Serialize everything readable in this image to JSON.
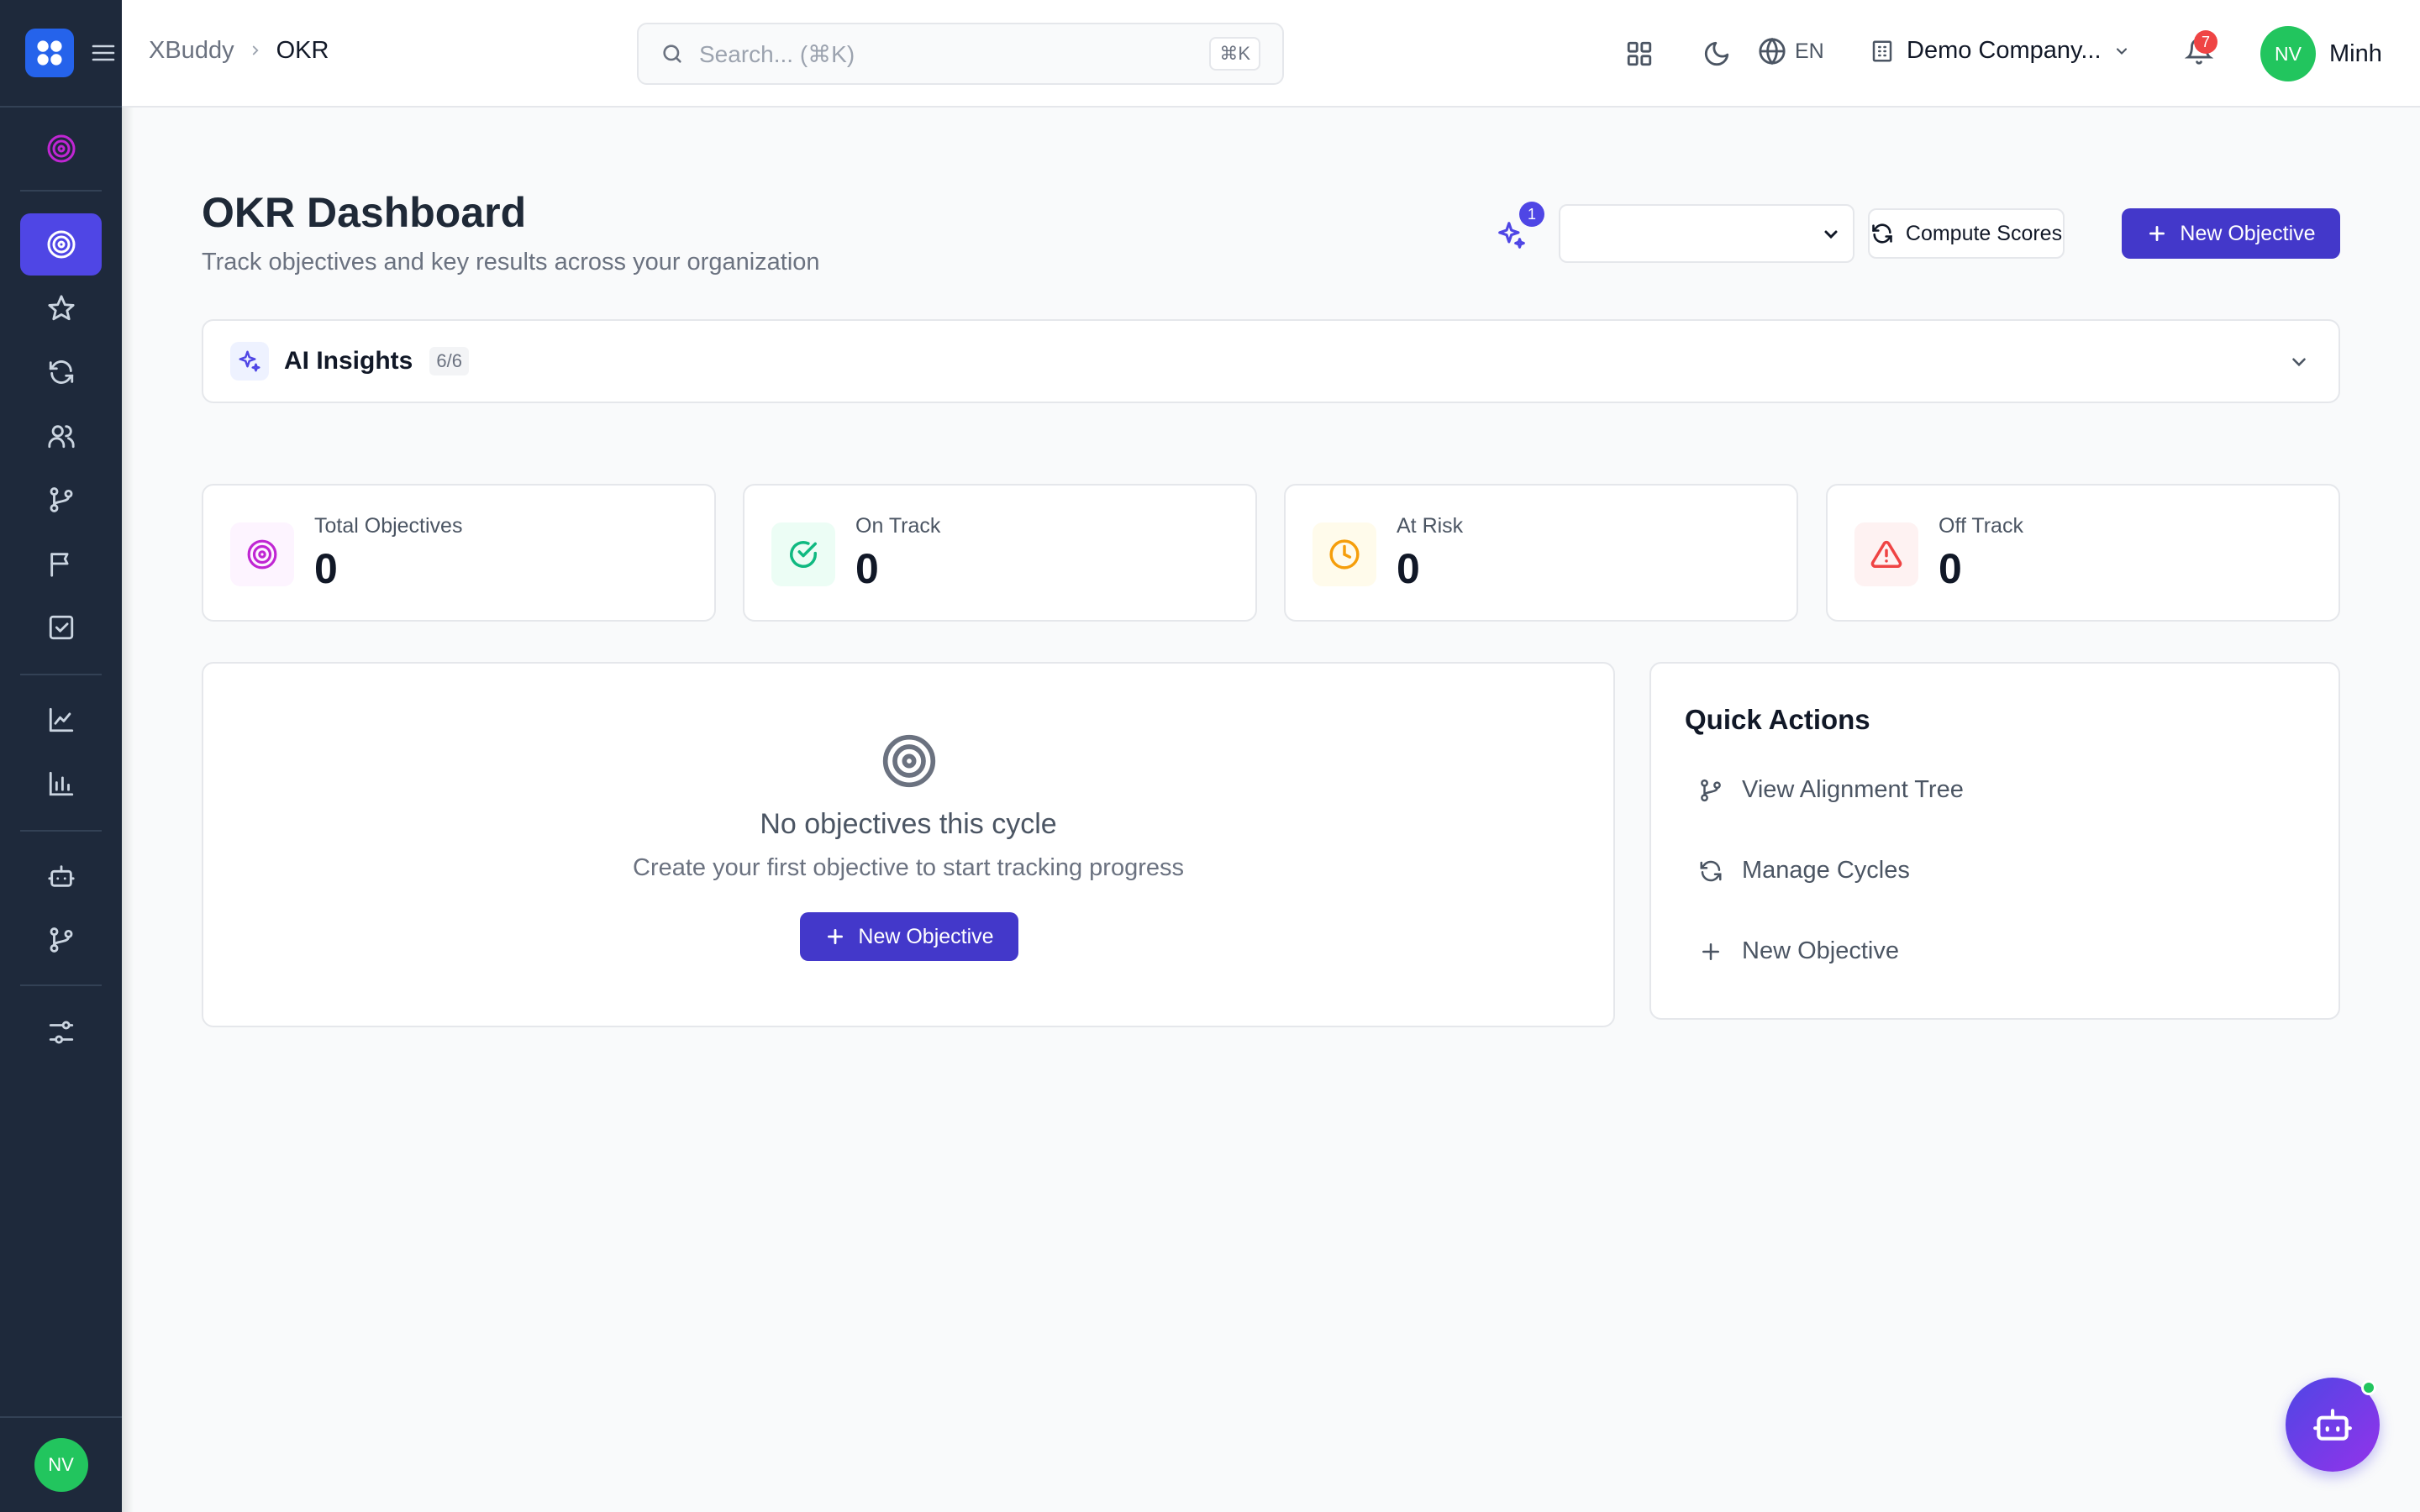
{
  "brand": {
    "accent": "#4f46e5",
    "sidebar_bg": "#1e293b",
    "success": "#22c55e",
    "danger": "#ef4444",
    "warning": "#f59e0b"
  },
  "sidebar": {
    "items": [
      {
        "icon": "target-icon",
        "active": false
      },
      {
        "icon": "target-icon",
        "active": true
      },
      {
        "icon": "star-icon"
      },
      {
        "icon": "refresh-icon"
      },
      {
        "icon": "users-icon"
      },
      {
        "icon": "git-branch-icon"
      },
      {
        "icon": "flag-icon"
      },
      {
        "icon": "check-square-icon"
      },
      {
        "icon": "line-chart-icon"
      },
      {
        "icon": "bar-chart-icon"
      },
      {
        "icon": "bot-icon"
      },
      {
        "icon": "git-branch-icon"
      },
      {
        "icon": "sliders-icon"
      }
    ],
    "user_initials": "NV"
  },
  "header": {
    "breadcrumb": [
      "XBuddy",
      "OKR"
    ],
    "search": {
      "placeholder": "Search... (⌘K)",
      "shortcut": "⌘K"
    },
    "language": "EN",
    "company": "Demo Company...",
    "notification_count": "7",
    "user": {
      "initials": "NV",
      "name": "Minh"
    }
  },
  "page": {
    "title": "OKR Dashboard",
    "subtitle": "Track objectives and key results across your organization",
    "spark_badge": "1",
    "cycle_select_value": "",
    "compute_label": "Compute Scores",
    "new_objective_label": "New Objective"
  },
  "insights": {
    "label": "AI Insights",
    "count": "6/6"
  },
  "stats": [
    {
      "label": "Total Objectives",
      "value": "0",
      "icon": "target-icon",
      "color": "#c026d3"
    },
    {
      "label": "On Track",
      "value": "0",
      "icon": "check-circle-icon",
      "color": "#10b981"
    },
    {
      "label": "At Risk",
      "value": "0",
      "icon": "clock-icon",
      "color": "#f59e0b"
    },
    {
      "label": "Off Track",
      "value": "0",
      "icon": "alert-triangle-icon",
      "color": "#ef4444"
    }
  ],
  "empty": {
    "title": "No objectives this cycle",
    "subtitle": "Create your first objective to start tracking progress",
    "button": "New Objective"
  },
  "quick_actions": {
    "title": "Quick Actions",
    "items": [
      {
        "label": "View Alignment Tree",
        "icon": "git-branch-icon"
      },
      {
        "label": "Manage Cycles",
        "icon": "refresh-icon"
      },
      {
        "label": "New Objective",
        "icon": "plus-icon"
      }
    ]
  }
}
